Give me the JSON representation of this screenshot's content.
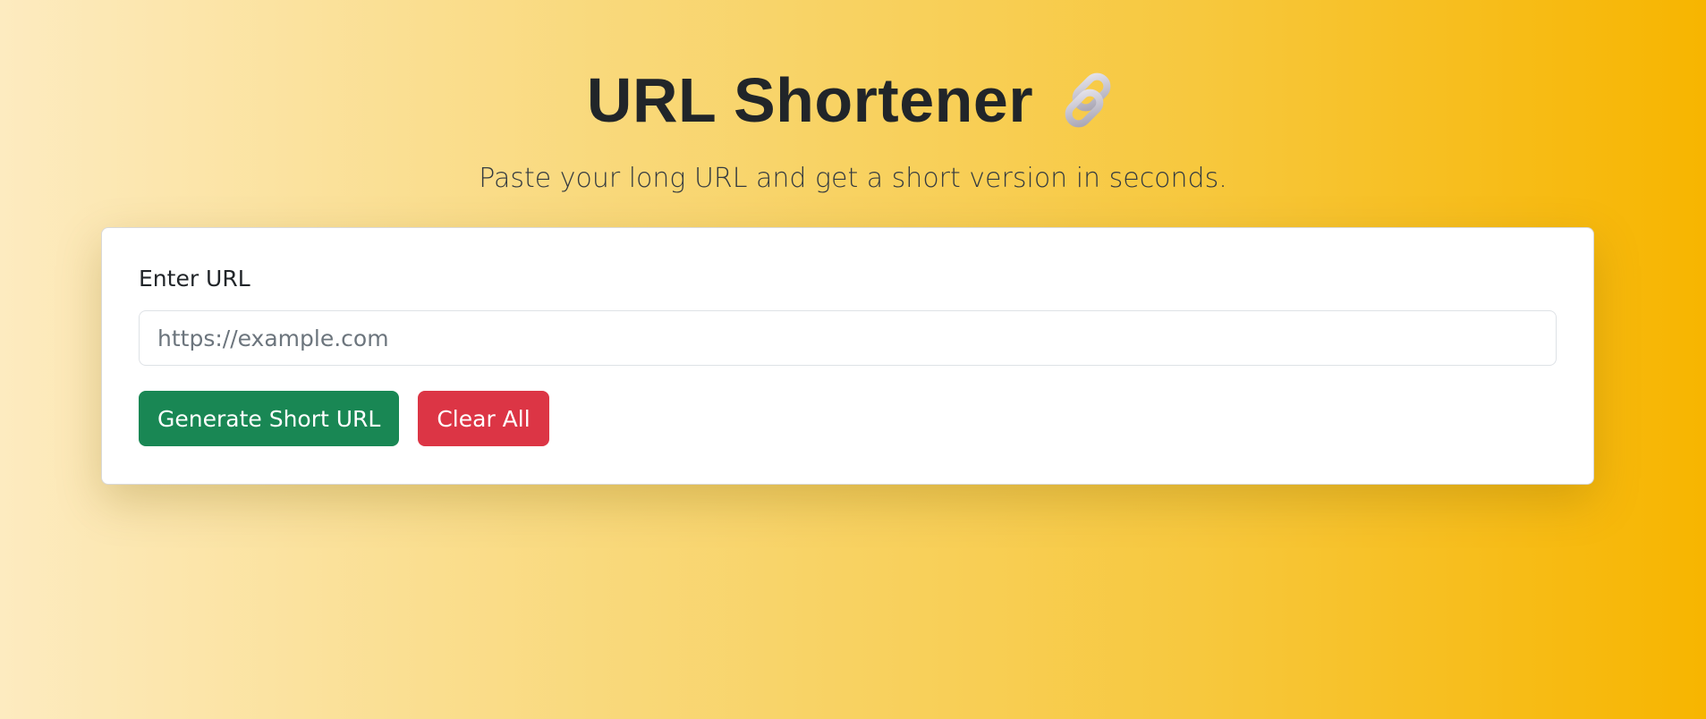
{
  "header": {
    "title": "URL Shortener",
    "title_icon": "link-icon",
    "subtitle": "Paste your long URL and get a short version in seconds."
  },
  "form": {
    "label": "Enter URL",
    "input_value": "",
    "input_placeholder": "https://example.com",
    "generate_label": "Generate Short URL",
    "clear_label": "Clear All"
  },
  "colors": {
    "generate_button": "#198754",
    "clear_button": "#dc3545",
    "background_start": "#fdebc0",
    "background_end": "#f7b500"
  }
}
